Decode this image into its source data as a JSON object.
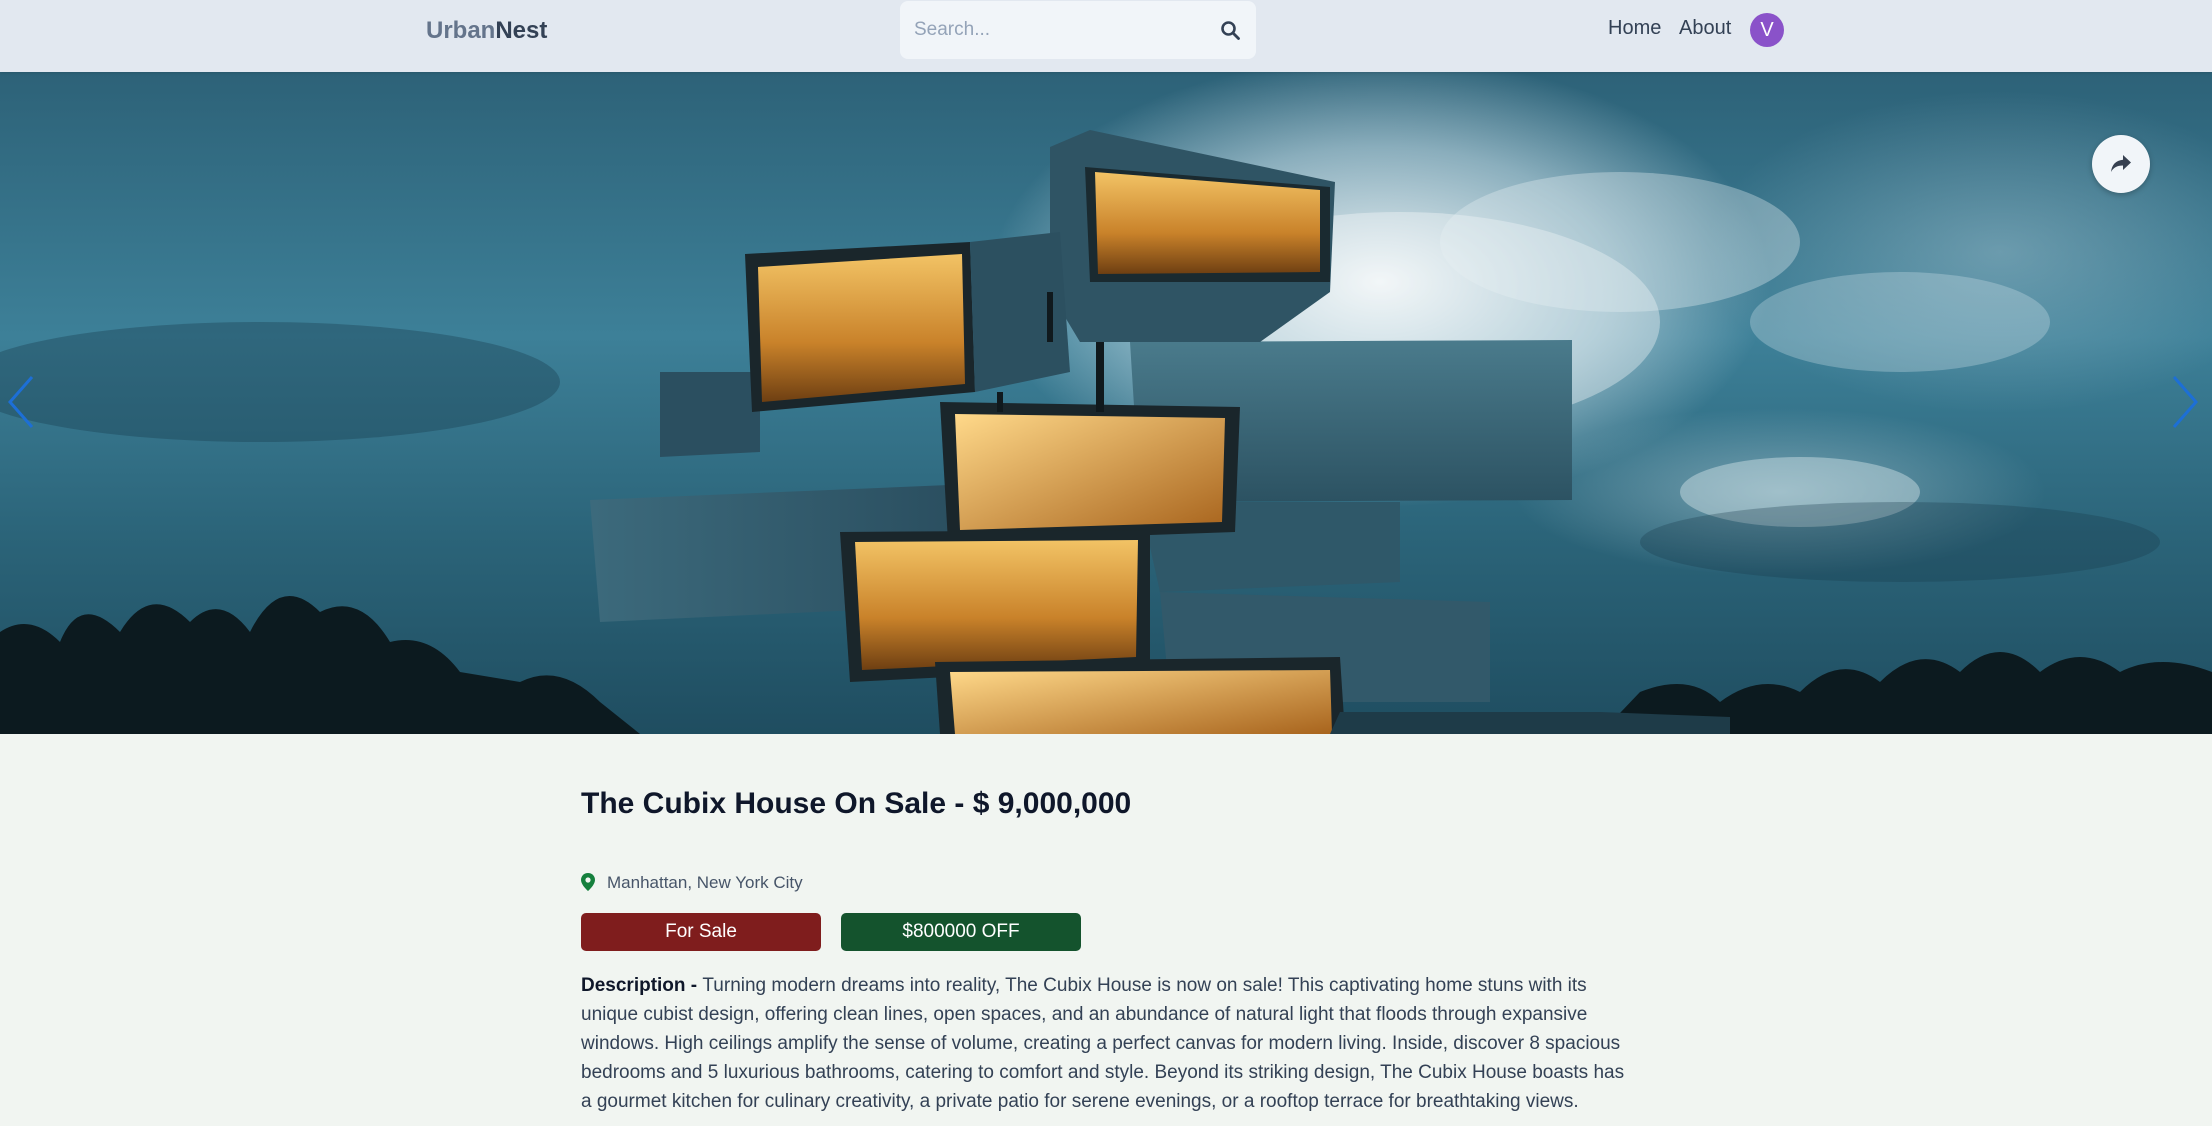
{
  "header": {
    "logo_part1": "Urban",
    "logo_part2": "Nest",
    "search_placeholder": "Search...",
    "nav_home": "Home",
    "nav_about": "About",
    "avatar_initial": "V"
  },
  "listing": {
    "title": "The Cubix House On Sale - $ 9,000,000",
    "location": "Manhattan, New York City",
    "badge_type": "For Sale",
    "badge_discount": "$800000 OFF",
    "description_label": "Description - ",
    "description_text": "Turning modern dreams into reality, The Cubix House is now on sale! This captivating home stuns with its unique cubist design, offering clean lines, open spaces, and an abundance of natural light that floods through expansive windows. High ceilings amplify the sense of volume, creating a perfect canvas for modern living. Inside, discover 8 spacious bedrooms and 5 luxurious bathrooms, catering to comfort and style. Beyond its striking design, The Cubix House boasts has a gourmet kitchen for culinary creativity, a private patio for serene evenings, or a rooftop terrace for breathtaking views."
  },
  "icons": {
    "search": "search-icon",
    "share": "share-icon",
    "location": "map-pin-icon",
    "prev": "chevron-left-icon",
    "next": "chevron-right-icon"
  },
  "colors": {
    "header_bg": "#e2e8f0",
    "page_bg": "#f1f5f1",
    "avatar_bg": "#8a52c9",
    "sale_badge": "#7f1d1d",
    "discount_badge": "#14532d",
    "location_pin": "#15803d",
    "slider_arrow": "#1d6fd6"
  }
}
